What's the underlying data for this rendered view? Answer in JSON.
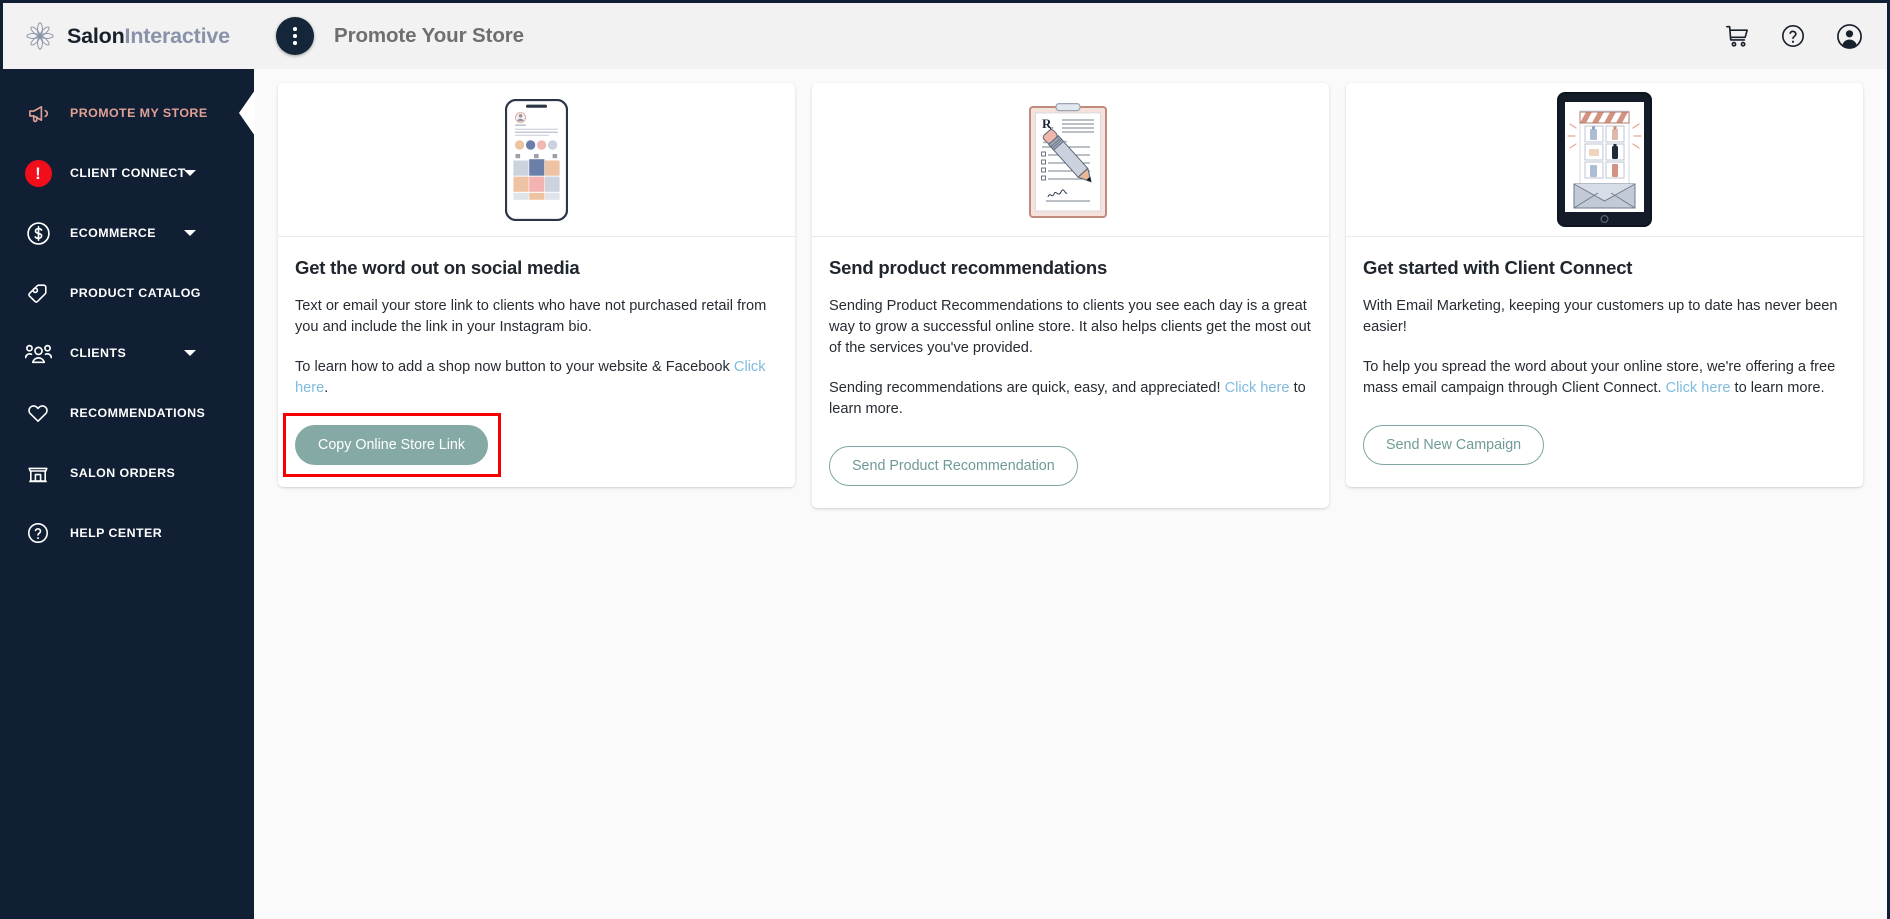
{
  "brand": {
    "name_part1": "Salon",
    "name_part2": "Interactive",
    "logo_icon": "asterisk-flower-logo"
  },
  "sidebar": {
    "items": [
      {
        "label": "PROMOTE MY STORE",
        "icon": "megaphone-icon",
        "active": true,
        "expandable": false
      },
      {
        "label": "CLIENT CONNECT",
        "icon": "alert-circle-icon",
        "active": false,
        "expandable": true
      },
      {
        "label": "ECOMMERCE",
        "icon": "dollar-circle-icon",
        "active": false,
        "expandable": true
      },
      {
        "label": "PRODUCT CATALOG",
        "icon": "tag-icon",
        "active": false,
        "expandable": false
      },
      {
        "label": "CLIENTS",
        "icon": "users-icon",
        "active": false,
        "expandable": true
      },
      {
        "label": "RECOMMENDATIONS",
        "icon": "heart-icon",
        "active": false,
        "expandable": false
      },
      {
        "label": "SALON ORDERS",
        "icon": "storefront-icon",
        "active": false,
        "expandable": false
      },
      {
        "label": "HELP CENTER",
        "icon": "question-circle-icon",
        "active": false,
        "expandable": false
      }
    ]
  },
  "header": {
    "title": "Promote Your Store",
    "menu_icon": "kebab-menu-icon",
    "actions": [
      {
        "icon": "shopping-cart-icon",
        "name": "cart-button"
      },
      {
        "icon": "question-circle-icon",
        "name": "help-button"
      },
      {
        "icon": "user-account-icon",
        "name": "account-button"
      }
    ]
  },
  "cards": [
    {
      "illustration": "smartphone-social-feed-illustration",
      "title": "Get the word out on social media",
      "paragraph1": "Text or email your store link to clients who have not purchased retail from you and include the link in your Instagram bio.",
      "paragraph2_pre": "To learn how to add a shop now button to your website & Facebook ",
      "paragraph2_link": "Click here",
      "paragraph2_post": ".",
      "button_label": "Copy Online Store Link",
      "button_style": "solid",
      "highlighted": true
    },
    {
      "illustration": "prescription-clipboard-pencil-illustration",
      "title": "Send product recommendations",
      "paragraph1": "Sending Product Recommendations to clients you see each day is a great way to grow a successful online store. It also helps clients get the most out of the services you've provided.",
      "paragraph2_pre": "Sending recommendations are quick, easy, and appreciated! ",
      "paragraph2_link": "Click here",
      "paragraph2_post": " to learn more.",
      "button_label": "Send Product Recommendation",
      "button_style": "outline",
      "highlighted": false
    },
    {
      "illustration": "tablet-email-storefront-illustration",
      "title": "Get started with Client Connect",
      "paragraph1": "With Email Marketing, keeping your customers up to date has never been easier!",
      "paragraph2_pre": "To help you spread the word about your online store, we're offering a free mass email campaign through Client Connect. ",
      "paragraph2_link": "Click here",
      "paragraph2_post": " to learn more.",
      "button_label": "Send New Campaign",
      "button_style": "outline",
      "highlighted": false
    }
  ],
  "colors": {
    "sidebar_bg": "#101f33",
    "active_item": "#e0a195",
    "alert_badge": "#f20d1b",
    "button_solid": "#85a9a5",
    "button_outline_text": "#6f9a97",
    "link": "#7fbbdd",
    "highlight_box": "#f60000",
    "page_bg": "#fafafa"
  }
}
